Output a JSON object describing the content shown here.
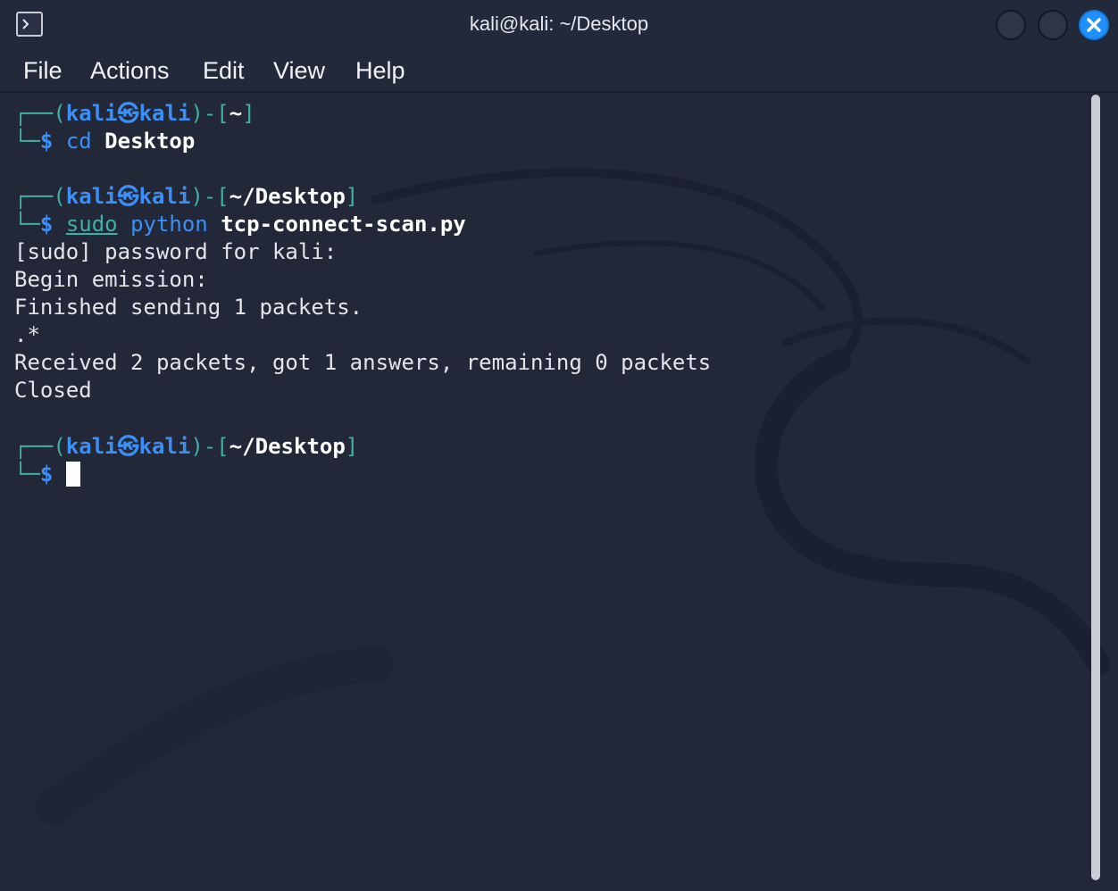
{
  "window": {
    "title": "kali@kali: ~/Desktop",
    "colors": {
      "background": "#232838",
      "titlebar": "#22293a",
      "close": "#1e90ff"
    }
  },
  "menu": {
    "items": [
      "File",
      "Actions",
      "Edit",
      "View",
      "Help"
    ]
  },
  "terminal": {
    "prompt1": {
      "user": "kali",
      "host": "kali",
      "dir": "~",
      "cmd": "cd",
      "arg": "Desktop"
    },
    "prompt2": {
      "user": "kali",
      "host": "kali",
      "dir": "~/Desktop",
      "sudo": "sudo",
      "cmd": "python",
      "arg": "tcp-connect-scan.py"
    },
    "output": [
      "[sudo] password for kali:",
      "Begin emission:",
      "Finished sending 1 packets.",
      ".*",
      "Received 2 packets, got 1 answers, remaining 0 packets",
      "Closed"
    ],
    "prompt3": {
      "user": "kali",
      "host": "kali",
      "dir": "~/Desktop"
    },
    "glyphs": {
      "at_symbol": "㉿",
      "dollar": "$",
      "open": "┌──(",
      "mid": ")-[",
      "close": "]",
      "corner": "└─"
    }
  }
}
